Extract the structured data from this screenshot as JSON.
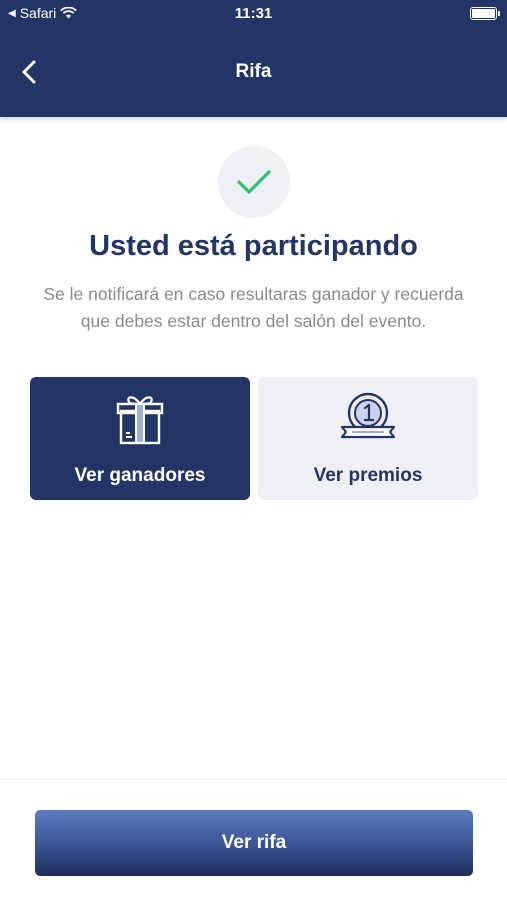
{
  "status_bar": {
    "carrier": "Safari",
    "time": "11:31"
  },
  "nav": {
    "title": "Rifa"
  },
  "confirmation": {
    "headline": "Usted está participando",
    "message": "Se le notificará en caso resultaras ganador y recuerda que debes estar dentro del salón del evento."
  },
  "cards": {
    "winners_label": "Ver ganadores",
    "prizes_label": "Ver premios"
  },
  "footer": {
    "primary_label": "Ver rifa"
  },
  "colors": {
    "brand_navy": "#233466",
    "check_green": "#2bbf6a",
    "muted_text": "#8a8a8a",
    "card_light": "#eef0f5"
  }
}
